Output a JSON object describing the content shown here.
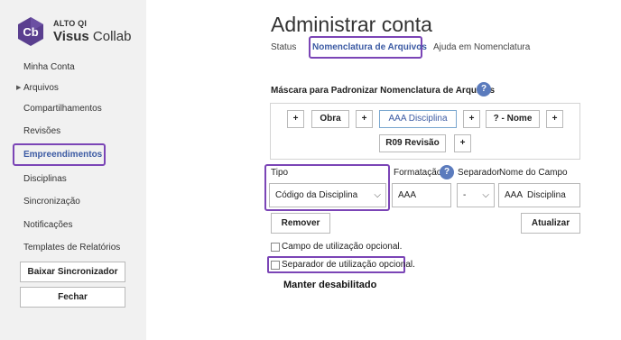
{
  "brand": {
    "logo_text": "Cb",
    "company": "ALTO QI",
    "product_bold": "Visus",
    "product_rest": " Collab"
  },
  "sidebar": {
    "items": [
      {
        "label": "Minha Conta"
      },
      {
        "label": "Arquivos"
      },
      {
        "label": "Compartilhamentos"
      },
      {
        "label": "Revisões"
      },
      {
        "label": "Empreendimentos"
      },
      {
        "label": "Disciplinas"
      },
      {
        "label": "Sincronização"
      },
      {
        "label": "Notificações"
      },
      {
        "label": "Templates de Relatórios"
      }
    ],
    "download_button": "Baixar Sincronizador",
    "close_button": "Fechar"
  },
  "main": {
    "title": "Administrar conta",
    "tabs": [
      {
        "label": "Status"
      },
      {
        "label": "Nomenclatura de Arquivos"
      },
      {
        "label": "Ajuda em Nomenclatura"
      }
    ],
    "mask": {
      "title": "Máscara para Padronizar Nomenclatura de Arquivos",
      "help": "?",
      "plus": "+",
      "chips": [
        "Obra",
        "AAA Disciplina",
        "? - Nome",
        "R09 Revisão"
      ]
    },
    "fields": {
      "tipo_label": "Tipo",
      "tipo_value": "Código da Disciplina",
      "formatacao_label": "Formatação",
      "formatacao_help": "?",
      "formatacao_value": "AAA",
      "separador_label": "Separador",
      "separador_value": "-",
      "nome_label": "Nome do Campo",
      "nome_value": "AAA  Disciplina",
      "chevron": "⌵"
    },
    "buttons": {
      "remove": "Remover",
      "update": "Atualizar"
    },
    "options": {
      "optional_field": "Campo de utilização opcional.",
      "optional_separator": "Separador de utilização opcional."
    },
    "note": "Manter desabilitado"
  },
  "colors": {
    "accent": "#3b5aa3",
    "highlight": "#7b45b6",
    "sidebar_bg": "#f1f1f1",
    "logo_bg": "#5a3f8f"
  }
}
